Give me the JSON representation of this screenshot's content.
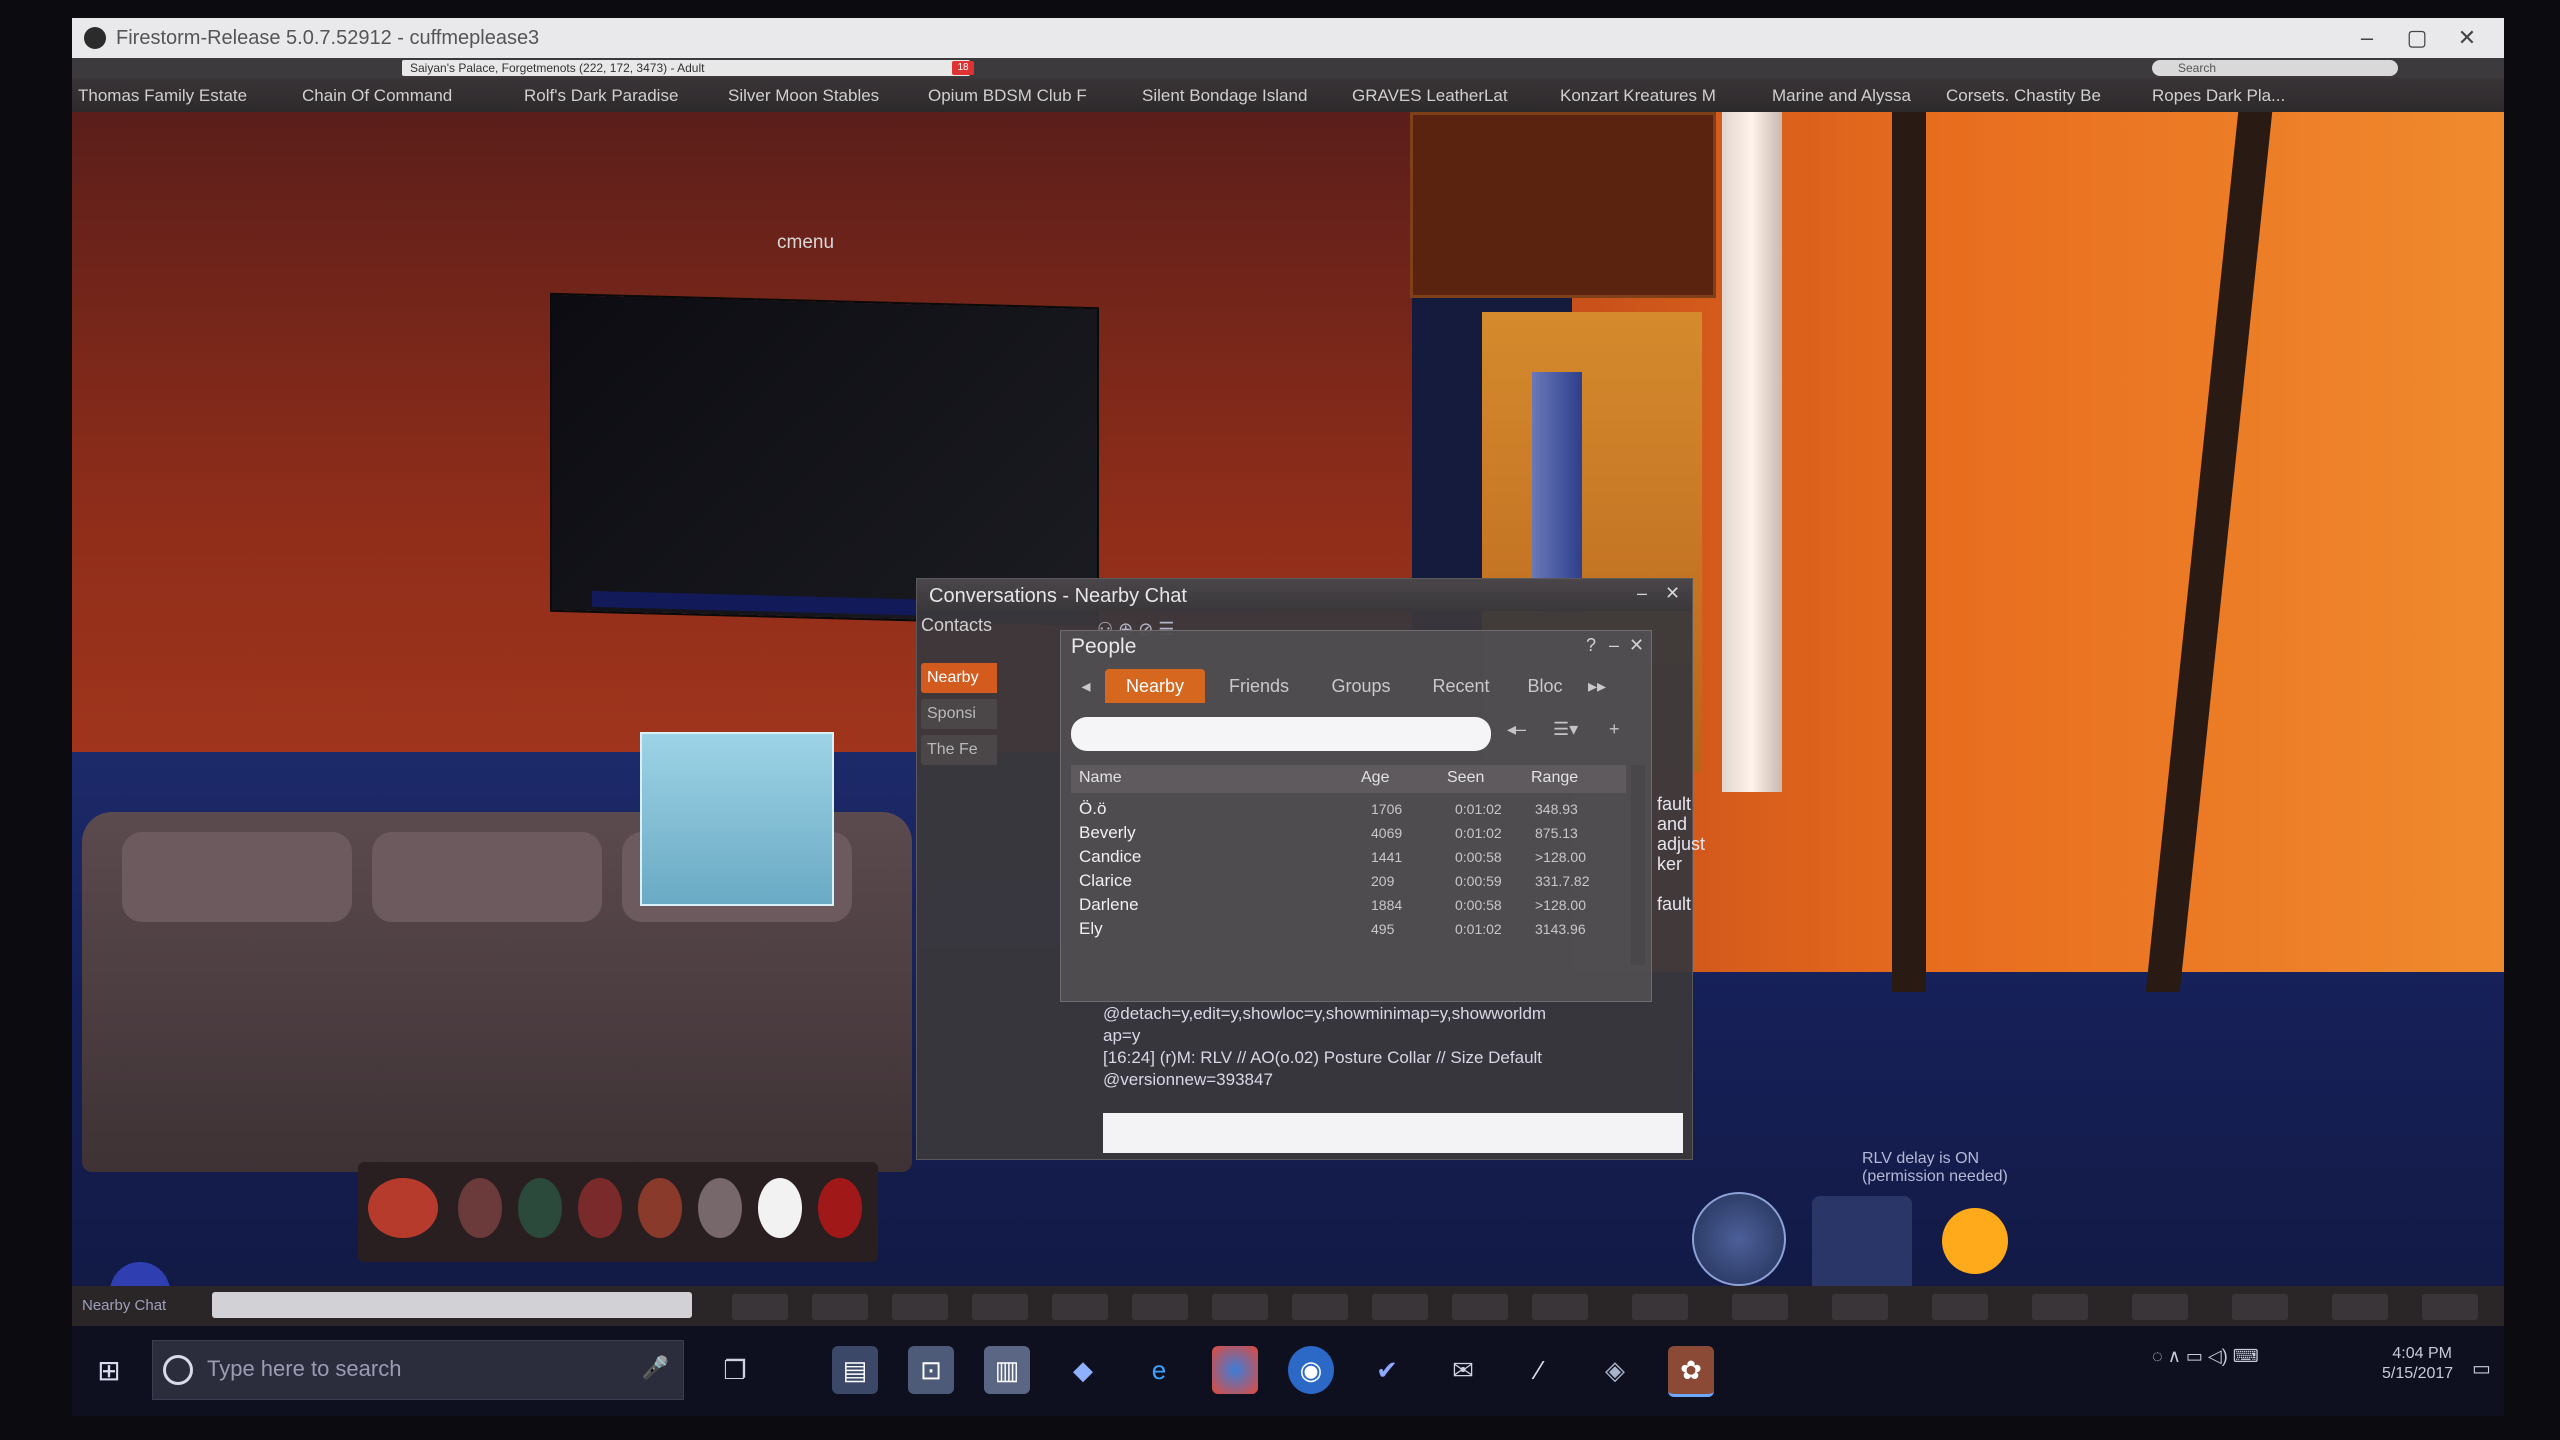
{
  "window": {
    "title": "Firestorm-Release 5.0.7.52912 - cuffmeplease3",
    "minimize": "–",
    "maximize": "▢",
    "close": "✕"
  },
  "navbar": {
    "location": "Saiyan's Palace, Forgetmenots (222, 172, 3473) - Adult",
    "badge": "18",
    "search_placeholder": "Search"
  },
  "favorites": [
    "Thomas Family Estate",
    "Chain Of Command",
    "Rolf's Dark Paradise",
    "Silver Moon Stables",
    "Opium BDSM Club F",
    "Silent Bondage Island",
    "GRAVES LeatherLat",
    "Konzart Kreatures M",
    "Marine and Alyssa",
    "Corsets. Chastity Be",
    "Ropes Dark Pla..."
  ],
  "scene": {
    "tv_label": "cmenu",
    "rlv_status_line1": "RLV delay is ON",
    "rlv_status_line2": "(permission needed)"
  },
  "conversations": {
    "title": "Conversations - Nearby Chat",
    "contacts_label": "Contacts",
    "side_tabs": [
      "Nearby",
      "Sponsi",
      "The Fe"
    ],
    "right_notes": [
      "fault",
      "and",
      "adjust",
      "ker",
      "fault"
    ],
    "log_line1": "@detach=y,edit=y,showloc=y,showminimap=y,showworldm",
    "log_line2": "ap=y",
    "log_line3": "[16:24] (r)M: RLV // AO(o.02) Posture Collar // Size Default",
    "log_line4": "@versionnew=393847"
  },
  "people": {
    "title": "People",
    "help": "?",
    "minimize": "–",
    "close": "✕",
    "tabs": [
      "Nearby",
      "Friends",
      "Groups",
      "Recent",
      "Bloc"
    ],
    "columns": {
      "name": "Name",
      "age": "Age",
      "seen": "Seen",
      "range": "Range"
    },
    "rows": [
      {
        "name": "Ö.ö",
        "age": "1706",
        "seen": "0:01:02",
        "range": "348.93"
      },
      {
        "name": "Beverly",
        "age": "4069",
        "seen": "0:01:02",
        "range": "875.13"
      },
      {
        "name": "Candice",
        "age": "1441",
        "seen": "0:00:58",
        "range": ">128.00"
      },
      {
        "name": "Clarice",
        "age": "209",
        "seen": "0:00:59",
        "range": "331.7.82"
      },
      {
        "name": "Darlene",
        "age": "1884",
        "seen": "0:00:58",
        "range": ">128.00"
      },
      {
        "name": "Ely",
        "age": "495",
        "seen": "0:01:02",
        "range": "3143.96"
      }
    ]
  },
  "bottom_bar": {
    "chat_label": "Nearby Chat"
  },
  "taskbar": {
    "start_glyph": "⊞",
    "search_placeholder": "Type here to search",
    "clock_time": "4:04 PM",
    "clock_date": "5/15/2017"
  },
  "colors": {
    "accent": "#d6671f",
    "floor": "#17215a",
    "wall_red": "#8c2c1a",
    "wall_orange": "#e86d1e"
  }
}
